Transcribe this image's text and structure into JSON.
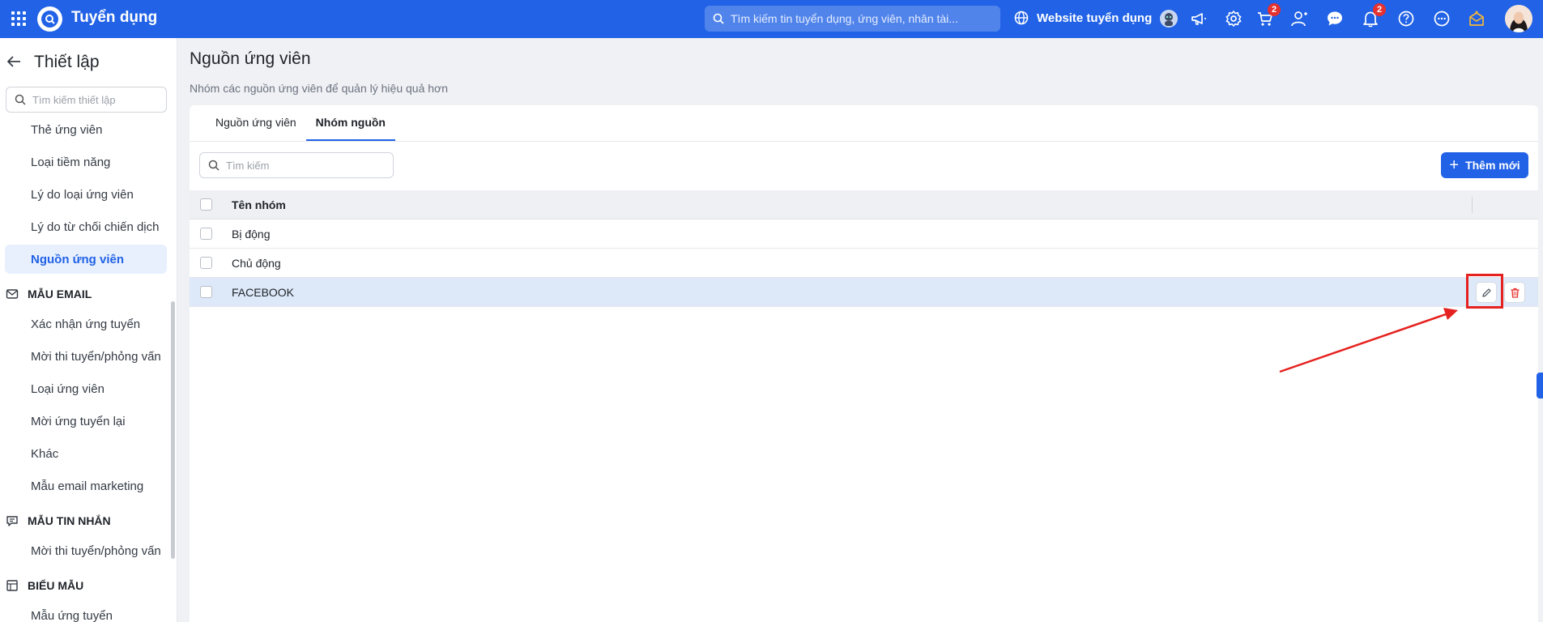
{
  "topbar": {
    "app_title": "Tuyển dụng",
    "search_placeholder": "Tìm kiếm tin tuyển dụng, ứng viên, nhân tài...",
    "website_label": "Website tuyển dụng",
    "cart_badge": "2",
    "notification_badge": "2",
    "accent": "#2162e6",
    "icons": [
      "apps-grid-icon",
      "logo-icon",
      "search-icon",
      "globe-icon",
      "bot-avatar-icon",
      "megaphone-icon",
      "gear-icon",
      "cart-icon",
      "user-add-icon",
      "chat-icon",
      "bell-icon",
      "help-icon",
      "more-icon",
      "reward-icon",
      "user-avatar"
    ]
  },
  "sidebar": {
    "title": "Thiết lập",
    "search_placeholder": "Tìm kiếm thiết lập",
    "items_top": [
      "Thẻ ứng viên",
      "Loại tiềm năng",
      "Lý do loại ứng viên",
      "Lý do từ chối chiến dịch",
      "Nguồn ứng viên"
    ],
    "active_item": "Nguồn ứng viên",
    "groups": [
      {
        "title": "MẪU EMAIL",
        "icon": "mail-icon",
        "items": [
          "Xác nhận ứng tuyển",
          "Mời thi tuyển/phỏng vấn",
          "Loại ứng viên",
          "Mời ứng tuyển lại",
          "Khác",
          "Mẫu email marketing"
        ]
      },
      {
        "title": "MẪU TIN NHẮN",
        "icon": "message-icon",
        "items": [
          "Mời thi tuyển/phỏng vấn"
        ]
      },
      {
        "title": "BIỂU MẪU",
        "icon": "form-icon",
        "items": [
          "Mẫu ứng tuyển"
        ]
      }
    ]
  },
  "main": {
    "title": "Nguồn ứng viên",
    "subtitle": "Nhóm các nguồn ứng viên để quản lý hiệu quả hơn",
    "tabs": [
      {
        "label": "Nguồn ứng viên",
        "active": false
      },
      {
        "label": "Nhóm nguồn",
        "active": true
      }
    ],
    "search_placeholder": "Tìm kiếm",
    "add_button": "Thêm mới",
    "table": {
      "header": "Tên nhóm",
      "rows": [
        "Bị động",
        "Chủ động",
        "FACEBOOK"
      ],
      "selected_row": "FACEBOOK"
    },
    "annotation_color": "#e5221f"
  }
}
